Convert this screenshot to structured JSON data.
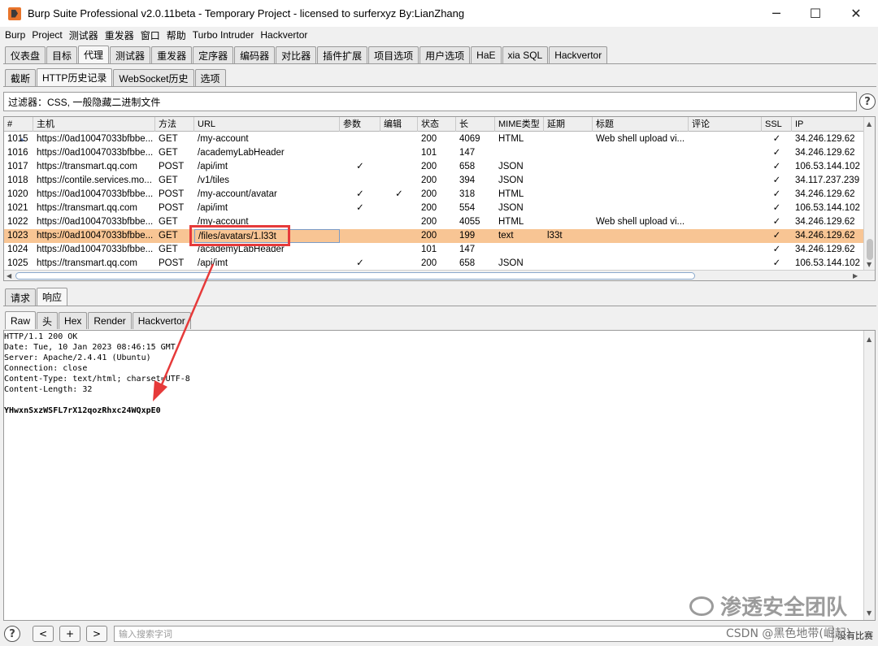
{
  "window": {
    "title": "Burp Suite Professional v2.0.11beta - Temporary Project - licensed to surferxyz By:LianZhang",
    "minimize": "─",
    "maximize": "☐",
    "close": "✕"
  },
  "menu": [
    "Burp",
    "Project",
    "测试器",
    "重发器",
    "窗口",
    "帮助",
    "Turbo Intruder",
    "Hackvertor"
  ],
  "main_tabs": [
    "仪表盘",
    "目标",
    "代理",
    "测试器",
    "重发器",
    "定序器",
    "编码器",
    "对比器",
    "插件扩展",
    "项目选项",
    "用户选项",
    "HaE",
    "xia SQL",
    "Hackvertor"
  ],
  "main_tab_active": 2,
  "proxy_tabs": [
    "截断",
    "HTTP历史记录",
    "WebSocket历史",
    "选项"
  ],
  "proxy_tab_active": 1,
  "filter": {
    "text": "过滤器：CSS, 一般隐藏二进制文件",
    "help": "?"
  },
  "columns": [
    "#",
    "主机",
    "方法",
    "URL",
    "参数",
    "编辑",
    "状态",
    "长",
    "MIME类型",
    "延期",
    "标题",
    "评论",
    "SSL",
    "IP"
  ],
  "sort_icon": "▲",
  "rows": [
    {
      "id": "1015",
      "host": "https://0ad10047033bfbbe...",
      "method": "GET",
      "url": "/my-account",
      "params": "",
      "edited": "",
      "status": "200",
      "length": "4069",
      "mime": "HTML",
      "ext": "",
      "title": "Web shell upload vi...",
      "comment": "",
      "ssl": "✓",
      "ip": "34.246.129.62"
    },
    {
      "id": "1016",
      "host": "https://0ad10047033bfbbe...",
      "method": "GET",
      "url": "/academyLabHeader",
      "params": "",
      "edited": "",
      "status": "101",
      "length": "147",
      "mime": "",
      "ext": "",
      "title": "",
      "comment": "",
      "ssl": "✓",
      "ip": "34.246.129.62"
    },
    {
      "id": "1017",
      "host": "https://transmart.qq.com",
      "method": "POST",
      "url": "/api/imt",
      "params": "✓",
      "edited": "",
      "status": "200",
      "length": "658",
      "mime": "JSON",
      "ext": "",
      "title": "",
      "comment": "",
      "ssl": "✓",
      "ip": "106.53.144.102"
    },
    {
      "id": "1018",
      "host": "https://contile.services.mo...",
      "method": "GET",
      "url": "/v1/tiles",
      "params": "",
      "edited": "",
      "status": "200",
      "length": "394",
      "mime": "JSON",
      "ext": "",
      "title": "",
      "comment": "",
      "ssl": "✓",
      "ip": "34.117.237.239"
    },
    {
      "id": "1020",
      "host": "https://0ad10047033bfbbe...",
      "method": "POST",
      "url": "/my-account/avatar",
      "params": "✓",
      "edited": "✓",
      "status": "200",
      "length": "318",
      "mime": "HTML",
      "ext": "",
      "title": "",
      "comment": "",
      "ssl": "✓",
      "ip": "34.246.129.62"
    },
    {
      "id": "1021",
      "host": "https://transmart.qq.com",
      "method": "POST",
      "url": "/api/imt",
      "params": "✓",
      "edited": "",
      "status": "200",
      "length": "554",
      "mime": "JSON",
      "ext": "",
      "title": "",
      "comment": "",
      "ssl": "✓",
      "ip": "106.53.144.102"
    },
    {
      "id": "1022",
      "host": "https://0ad10047033bfbbe...",
      "method": "GET",
      "url": "/my-account",
      "params": "",
      "edited": "",
      "status": "200",
      "length": "4055",
      "mime": "HTML",
      "ext": "",
      "title": "Web shell upload vi...",
      "comment": "",
      "ssl": "✓",
      "ip": "34.246.129.62"
    },
    {
      "id": "1023",
      "host": "https://0ad10047033bfbbe...",
      "method": "GET",
      "url": "/files/avatars/1.l33t",
      "params": "",
      "edited": "",
      "status": "200",
      "length": "199",
      "mime": "text",
      "ext": "l33t",
      "title": "",
      "comment": "",
      "ssl": "✓",
      "ip": "34.246.129.62"
    },
    {
      "id": "1024",
      "host": "https://0ad10047033bfbbe...",
      "method": "GET",
      "url": "/academyLabHeader",
      "params": "",
      "edited": "",
      "status": "101",
      "length": "147",
      "mime": "",
      "ext": "",
      "title": "",
      "comment": "",
      "ssl": "✓",
      "ip": "34.246.129.62"
    },
    {
      "id": "1025",
      "host": "https://transmart.qq.com",
      "method": "POST",
      "url": "/api/imt",
      "params": "✓",
      "edited": "",
      "status": "200",
      "length": "658",
      "mime": "JSON",
      "ext": "",
      "title": "",
      "comment": "",
      "ssl": "✓",
      "ip": "106.53.144.102"
    }
  ],
  "selected_row": 7,
  "req_resp_tabs": [
    "请求",
    "响应"
  ],
  "req_resp_active": 1,
  "view_tabs": [
    "Raw",
    "头",
    "Hex",
    "Render",
    "Hackvertor"
  ],
  "view_active": 0,
  "response": {
    "headers": "HTTP/1.1 200 OK\nDate: Tue, 10 Jan 2023 08:46:15 GMT\nServer: Apache/2.4.41 (Ubuntu)\nConnection: close\nContent-Type: text/html; charset=UTF-8\nContent-Length: 32",
    "body": "YHwxnSxzWSFL7rX12qozRhxc24WQxpE0"
  },
  "bottom": {
    "help": "?",
    "prev": "<",
    "add": "+",
    "next": ">",
    "search_placeholder": "输入搜索字词",
    "matches": "没有比赛"
  },
  "watermark": {
    "text": "渗透安全团队",
    "csdn": "CSDN @黑色地带(崛起)"
  },
  "colors": {
    "selected_row": "#f8c594",
    "highlight_box": "#e63a3a",
    "arrow": "#e63a3a",
    "brand": "#e8742b"
  }
}
